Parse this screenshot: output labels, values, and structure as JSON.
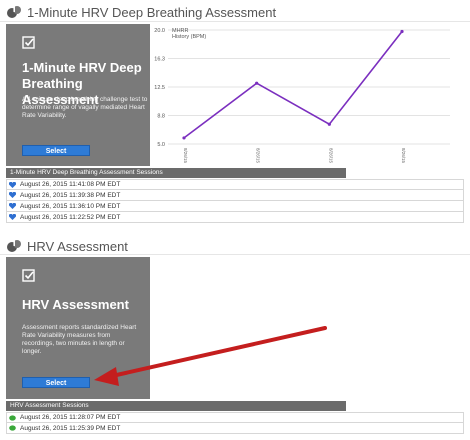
{
  "section1": {
    "title": "1-Minute HRV Deep Breathing Assessment",
    "card": {
      "title": "1-Minute HRV Deep Breathing Assessment",
      "description": "A 1-minute deep breathing challenge test to determine range of vagally mediated Heart Rate Variability.",
      "button": "Select"
    },
    "sessions_header": "1-Minute HRV Deep Breathing Assessment Sessions",
    "sessions": [
      "August 26, 2015 11:41:08 PM EDT",
      "August 26, 2015 11:39:38 PM EDT",
      "August 26, 2015 11:36:10 PM EDT",
      "August 26, 2015 11:22:52 PM EDT"
    ]
  },
  "section2": {
    "title": "HRV Assessment",
    "card": {
      "title": "HRV Assessment",
      "description": "Assessment reports standardized Heart Rate Variability measures from recordings, two minutes in length or longer.",
      "button": "Select"
    },
    "sessions_header": "HRV Assessment Sessions",
    "sessions": [
      "August 26, 2015 11:28:07 PM EDT",
      "August 26, 2015 11:25:39 PM EDT"
    ]
  },
  "colors": {
    "card_bg": "#7a7a7a",
    "button": "#2e7bd6",
    "line": "#7b2fbf",
    "arrow": "#c41e1e",
    "blue_icon": "#2e6fd1",
    "green_icon": "#3aa83a"
  },
  "icons": {
    "section1_logo": "lungs-icon",
    "section2_logo": "lungs-icon",
    "card_icon": "checklist-icon",
    "session1_icon": "heart-icon",
    "session2_icon": "leaf-icon"
  },
  "chart_data": {
    "type": "line",
    "title": "",
    "ylabel": "MHRR History (BPM)",
    "ylim": [
      5.0,
      20.0
    ],
    "yticks": [
      "20.0",
      "16.3",
      "12.5",
      "8.8",
      "5.0"
    ],
    "x": [
      "8/26/15",
      "8/26/15",
      "8/26/15",
      "8/26/15"
    ],
    "values": [
      5.8,
      13.0,
      7.6,
      19.8
    ],
    "grid": true
  }
}
